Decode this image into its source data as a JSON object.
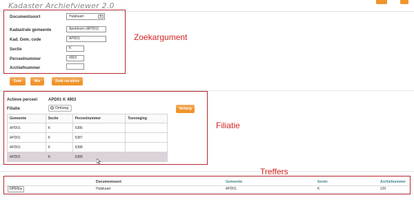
{
  "app": {
    "title": "Kadaster Archiefviewer 2.0"
  },
  "colors": {
    "accent_orange": "#f0942c",
    "annotation_red": "#d42424",
    "frame_red": "#b3242b",
    "teal_header": "#3e7f86",
    "selected_row": "#dcd3da"
  },
  "zoekargument": {
    "documentsoort_label": "Documentsoort",
    "documentsoort_value": "Hulpkaart",
    "kadastrale_gemeente_label": "Kadastrale gemeente",
    "kadastrale_gemeente_value": "Apeldoorn (APD01)",
    "kad_gem_code_label": "Kad. Gem. code",
    "kad_gem_code_value": "APD01",
    "sectie_label": "Sectie",
    "sectie_value": "K",
    "perceelnummer_label": "Perceelnummer",
    "perceelnummer_value": "4903",
    "archiefnummer_label": "Archiefnummer",
    "archiefnummer_value": "",
    "annotation": "Zoekargument"
  },
  "buttons": {
    "zoek": "Zoek",
    "wis": "Wis",
    "zoek_via_adres": "Zoek via adres",
    "verberg": "Verberg"
  },
  "filiatie": {
    "actieve_perceel_label": "Actieve perceel",
    "actieve_perceel_value": "APD01  K  4903",
    "filiatie_label": "Filiatie",
    "radio_label": "Omhoog",
    "annotation": "Filiatie",
    "columns": [
      "Gemeente",
      "Sectie",
      "Perceelnummer",
      "Toevoeging"
    ],
    "rows": [
      [
        "APD01",
        "K",
        "5386",
        ""
      ],
      [
        "APD01",
        "K",
        "5387",
        ""
      ],
      [
        "APD01",
        "K",
        "5388",
        ""
      ],
      [
        "APD01",
        "K",
        "5389",
        ""
      ]
    ]
  },
  "treffers": {
    "annotation": "Treffers",
    "columns": [
      "",
      "Documentsoort",
      "Gemeente",
      "Sectie",
      "Archiefnummer"
    ],
    "open_label": "OPEN",
    "rows": [
      [
        "",
        "Hulpkaart",
        "APD01",
        "K",
        "120"
      ]
    ]
  }
}
